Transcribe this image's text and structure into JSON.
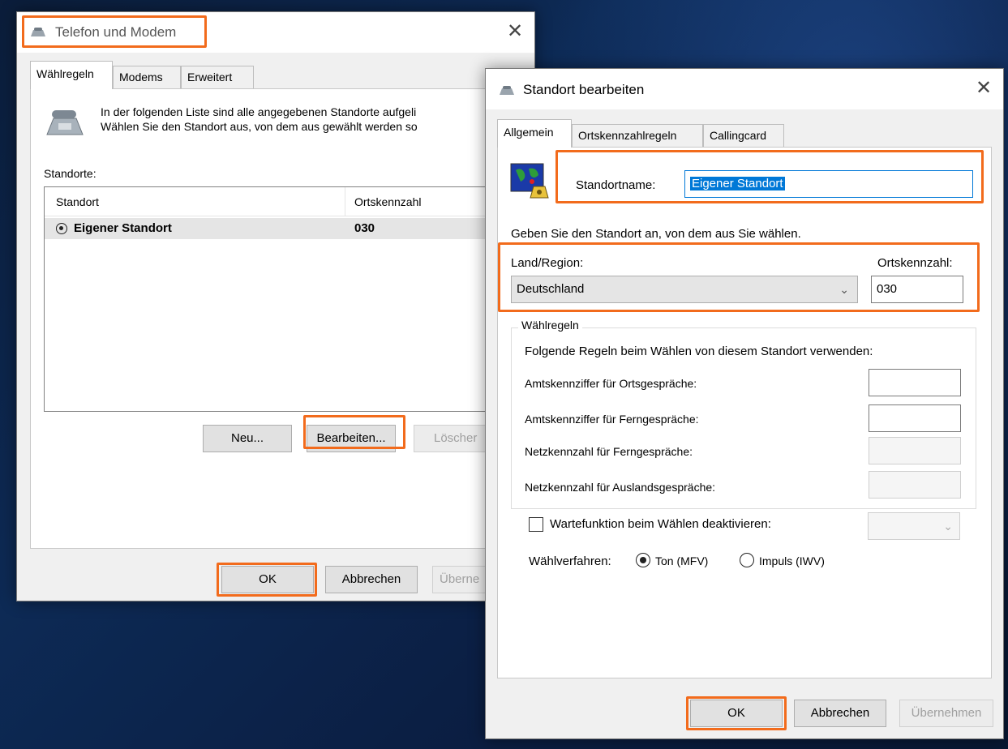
{
  "left_window": {
    "title": "Telefon und Modem",
    "tabs": [
      "Wählregeln",
      "Modems",
      "Erweitert"
    ],
    "info_line1": "In der folgenden Liste sind alle angegebenen Standorte aufgeli",
    "info_line2": "Wählen Sie den Standort aus, von dem aus gewählt werden so",
    "locations_label": "Standorte:",
    "table": {
      "headers": [
        "Standort",
        "Ortskennzahl"
      ],
      "rows": [
        {
          "name": "Eigener Standort",
          "code": "030"
        }
      ]
    },
    "buttons": {
      "new": "Neu...",
      "edit": "Bearbeiten...",
      "delete": "Löscher"
    },
    "footer": {
      "ok": "OK",
      "cancel": "Abbrechen",
      "apply": "Überne"
    }
  },
  "right_window": {
    "title": "Standort bearbeiten",
    "tabs": [
      "Allgemein",
      "Ortskennzahlregeln",
      "Callingcard"
    ],
    "location_name_label": "Standortname:",
    "location_name_value": "Eigener Standort",
    "info": "Geben Sie den Standort an, von dem aus Sie wählen.",
    "country_label": "Land/Region:",
    "country_value": "Deutschland",
    "area_code_label": "Ortskennzahl:",
    "area_code_value": "030",
    "dial_rules": {
      "legend": "Wählregeln",
      "intro": "Folgende Regeln beim Wählen von diesem Standort verwenden:",
      "local_prefix_label": "Amtskennziffer für Ortsgespräche:",
      "long_prefix_label": "Amtskennziffer für Ferngespräche:",
      "long_carrier_label": "Netzkennzahl für Ferngespräche:",
      "intl_carrier_label": "Netzkennzahl für Auslandsgespräche:"
    },
    "call_waiting_label": "Wartefunktion beim Wählen deaktivieren:",
    "dial_method_label": "Wählverfahren:",
    "dial_tone_label": "Ton (MFV)",
    "dial_pulse_label": "Impuls (IWV)",
    "footer": {
      "ok": "OK",
      "cancel": "Abbrechen",
      "apply": "Übernehmen"
    }
  },
  "colors": {
    "highlight": "#f26b1c",
    "selection": "#0078d7"
  },
  "icons": [
    "phone-modem-icon",
    "close-icon",
    "location-map-icon",
    "chevron-down-icon",
    "radio-icon",
    "checkbox-icon"
  ]
}
